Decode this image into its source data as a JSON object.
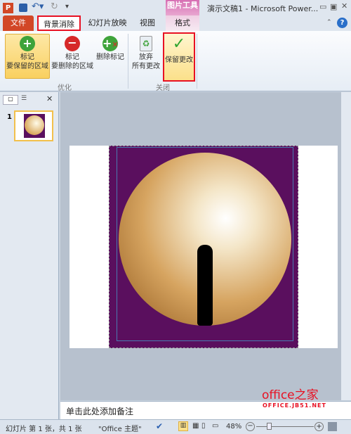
{
  "titlebar": {
    "title": "演示文稿1 - Microsoft Power...",
    "contextual_tab": "图片工具"
  },
  "tabs": [
    {
      "label": "文件"
    },
    {
      "label": "背景消除"
    },
    {
      "label": "幻灯片放映"
    },
    {
      "label": "视图"
    },
    {
      "label": "格式"
    }
  ],
  "ribbon": {
    "mark_keep": {
      "line1": "标记",
      "line2": "要保留的区域"
    },
    "mark_remove": {
      "line1": "标记",
      "line2": "要删除的区域"
    },
    "delete_mark": "删除标记",
    "discard": {
      "line1": "放弃",
      "line2": "所有更改"
    },
    "keep_changes": "保留更改",
    "group_refine": "优化",
    "group_close": "关闭"
  },
  "slides_panel": {
    "slide_number": "1"
  },
  "notes": {
    "placeholder": "单击此处添加备注"
  },
  "watermark": {
    "brand": "office之家",
    "url": "OFFICE.JB51.NET"
  },
  "status": {
    "slide_info": "幻灯片 第 1 张，共 1 张",
    "theme": "\"Office 主题\"",
    "zoom": "48%",
    "zoom_percent": 48
  },
  "colors": {
    "accent": "#d24726",
    "highlight": "#e81123",
    "purple": "#5a0f5e"
  }
}
